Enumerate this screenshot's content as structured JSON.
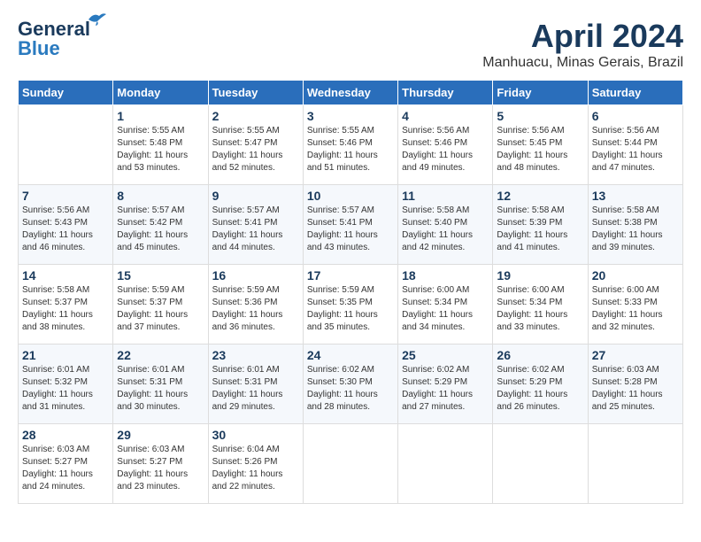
{
  "header": {
    "logo_line1": "General",
    "logo_line2": "Blue",
    "month_title": "April 2024",
    "subtitle": "Manhuacu, Minas Gerais, Brazil"
  },
  "calendar": {
    "weekdays": [
      "Sunday",
      "Monday",
      "Tuesday",
      "Wednesday",
      "Thursday",
      "Friday",
      "Saturday"
    ],
    "weeks": [
      [
        {
          "day": "",
          "info": ""
        },
        {
          "day": "1",
          "info": "Sunrise: 5:55 AM\nSunset: 5:48 PM\nDaylight: 11 hours\nand 53 minutes."
        },
        {
          "day": "2",
          "info": "Sunrise: 5:55 AM\nSunset: 5:47 PM\nDaylight: 11 hours\nand 52 minutes."
        },
        {
          "day": "3",
          "info": "Sunrise: 5:55 AM\nSunset: 5:46 PM\nDaylight: 11 hours\nand 51 minutes."
        },
        {
          "day": "4",
          "info": "Sunrise: 5:56 AM\nSunset: 5:46 PM\nDaylight: 11 hours\nand 49 minutes."
        },
        {
          "day": "5",
          "info": "Sunrise: 5:56 AM\nSunset: 5:45 PM\nDaylight: 11 hours\nand 48 minutes."
        },
        {
          "day": "6",
          "info": "Sunrise: 5:56 AM\nSunset: 5:44 PM\nDaylight: 11 hours\nand 47 minutes."
        }
      ],
      [
        {
          "day": "7",
          "info": "Sunrise: 5:56 AM\nSunset: 5:43 PM\nDaylight: 11 hours\nand 46 minutes."
        },
        {
          "day": "8",
          "info": "Sunrise: 5:57 AM\nSunset: 5:42 PM\nDaylight: 11 hours\nand 45 minutes."
        },
        {
          "day": "9",
          "info": "Sunrise: 5:57 AM\nSunset: 5:41 PM\nDaylight: 11 hours\nand 44 minutes."
        },
        {
          "day": "10",
          "info": "Sunrise: 5:57 AM\nSunset: 5:41 PM\nDaylight: 11 hours\nand 43 minutes."
        },
        {
          "day": "11",
          "info": "Sunrise: 5:58 AM\nSunset: 5:40 PM\nDaylight: 11 hours\nand 42 minutes."
        },
        {
          "day": "12",
          "info": "Sunrise: 5:58 AM\nSunset: 5:39 PM\nDaylight: 11 hours\nand 41 minutes."
        },
        {
          "day": "13",
          "info": "Sunrise: 5:58 AM\nSunset: 5:38 PM\nDaylight: 11 hours\nand 39 minutes."
        }
      ],
      [
        {
          "day": "14",
          "info": "Sunrise: 5:58 AM\nSunset: 5:37 PM\nDaylight: 11 hours\nand 38 minutes."
        },
        {
          "day": "15",
          "info": "Sunrise: 5:59 AM\nSunset: 5:37 PM\nDaylight: 11 hours\nand 37 minutes."
        },
        {
          "day": "16",
          "info": "Sunrise: 5:59 AM\nSunset: 5:36 PM\nDaylight: 11 hours\nand 36 minutes."
        },
        {
          "day": "17",
          "info": "Sunrise: 5:59 AM\nSunset: 5:35 PM\nDaylight: 11 hours\nand 35 minutes."
        },
        {
          "day": "18",
          "info": "Sunrise: 6:00 AM\nSunset: 5:34 PM\nDaylight: 11 hours\nand 34 minutes."
        },
        {
          "day": "19",
          "info": "Sunrise: 6:00 AM\nSunset: 5:34 PM\nDaylight: 11 hours\nand 33 minutes."
        },
        {
          "day": "20",
          "info": "Sunrise: 6:00 AM\nSunset: 5:33 PM\nDaylight: 11 hours\nand 32 minutes."
        }
      ],
      [
        {
          "day": "21",
          "info": "Sunrise: 6:01 AM\nSunset: 5:32 PM\nDaylight: 11 hours\nand 31 minutes."
        },
        {
          "day": "22",
          "info": "Sunrise: 6:01 AM\nSunset: 5:31 PM\nDaylight: 11 hours\nand 30 minutes."
        },
        {
          "day": "23",
          "info": "Sunrise: 6:01 AM\nSunset: 5:31 PM\nDaylight: 11 hours\nand 29 minutes."
        },
        {
          "day": "24",
          "info": "Sunrise: 6:02 AM\nSunset: 5:30 PM\nDaylight: 11 hours\nand 28 minutes."
        },
        {
          "day": "25",
          "info": "Sunrise: 6:02 AM\nSunset: 5:29 PM\nDaylight: 11 hours\nand 27 minutes."
        },
        {
          "day": "26",
          "info": "Sunrise: 6:02 AM\nSunset: 5:29 PM\nDaylight: 11 hours\nand 26 minutes."
        },
        {
          "day": "27",
          "info": "Sunrise: 6:03 AM\nSunset: 5:28 PM\nDaylight: 11 hours\nand 25 minutes."
        }
      ],
      [
        {
          "day": "28",
          "info": "Sunrise: 6:03 AM\nSunset: 5:27 PM\nDaylight: 11 hours\nand 24 minutes."
        },
        {
          "day": "29",
          "info": "Sunrise: 6:03 AM\nSunset: 5:27 PM\nDaylight: 11 hours\nand 23 minutes."
        },
        {
          "day": "30",
          "info": "Sunrise: 6:04 AM\nSunset: 5:26 PM\nDaylight: 11 hours\nand 22 minutes."
        },
        {
          "day": "",
          "info": ""
        },
        {
          "day": "",
          "info": ""
        },
        {
          "day": "",
          "info": ""
        },
        {
          "day": "",
          "info": ""
        }
      ]
    ]
  }
}
